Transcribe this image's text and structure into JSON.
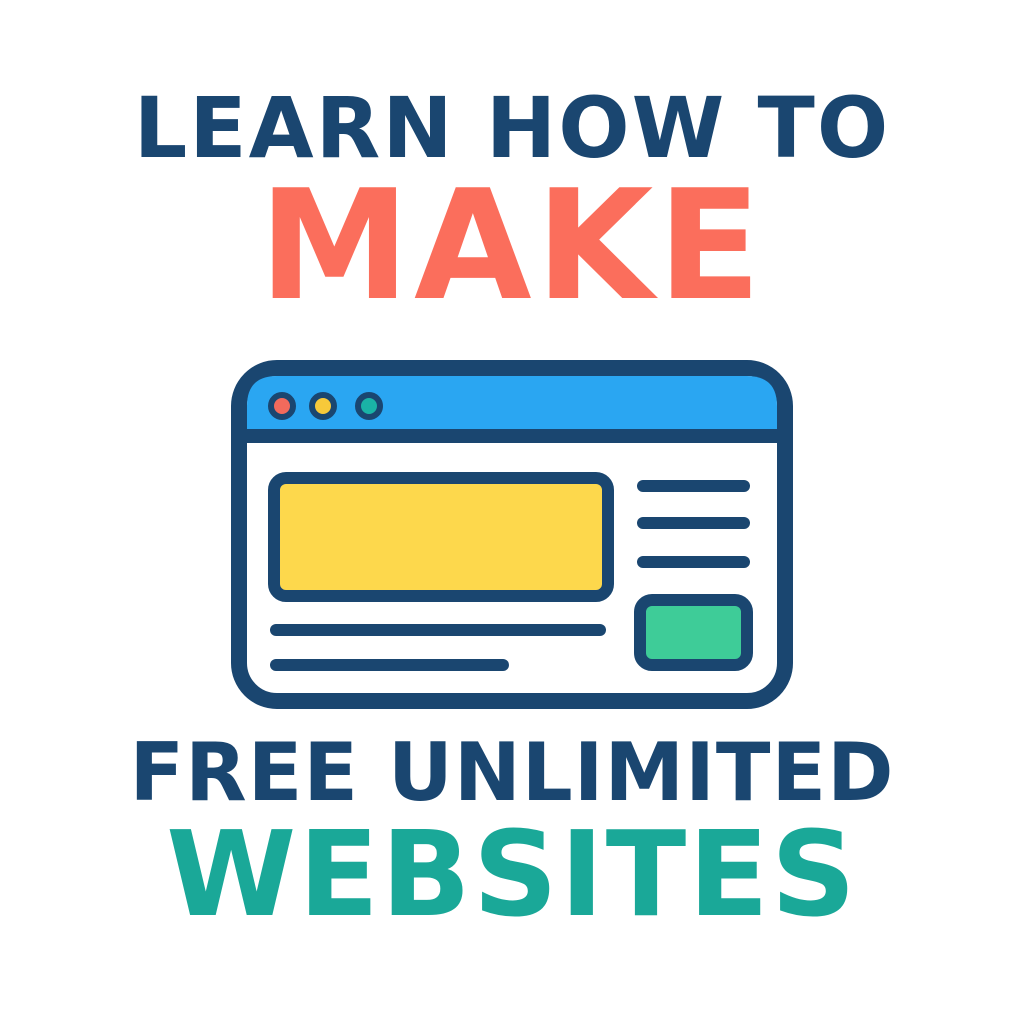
{
  "poster": {
    "line1": "LEARN HOW TO",
    "line2": "MAKE",
    "line3": "FREE UNLIMITED",
    "line4": "WEBSITES"
  },
  "colors": {
    "navy": "#1a4670",
    "coral": "#fb6e5c",
    "teal": "#1aa898",
    "browser_bar": "#2aa6f2",
    "hero_block": "#fdd84c",
    "button_block": "#3ecc98",
    "dot_red": "#f26a5c",
    "dot_yellow": "#f7c93a",
    "dot_teal": "#1ab3a6",
    "white": "#ffffff"
  },
  "illustration": {
    "icon": "browser-window-icon"
  }
}
